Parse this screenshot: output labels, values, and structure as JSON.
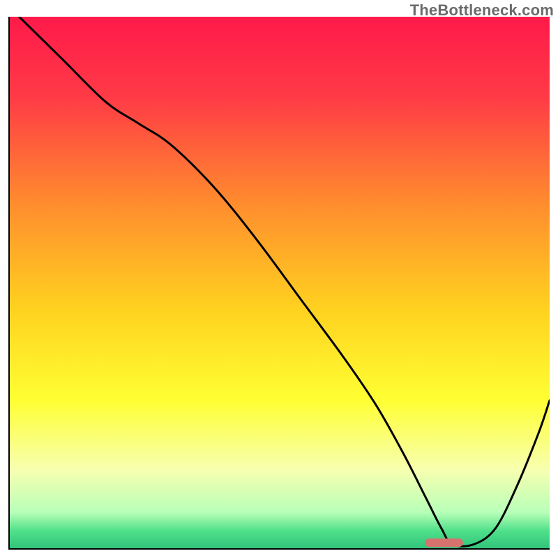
{
  "watermark": "TheBottleneck.com",
  "chart_data": {
    "type": "line",
    "title": "",
    "xlabel": "",
    "ylabel": "",
    "xlim": [
      0,
      100
    ],
    "ylim": [
      0,
      100
    ],
    "grid": false,
    "legend": false,
    "background_gradient": [
      {
        "offset": 0.0,
        "color": "#ff1a4a"
      },
      {
        "offset": 0.15,
        "color": "#ff3a46"
      },
      {
        "offset": 0.35,
        "color": "#ff8c2e"
      },
      {
        "offset": 0.55,
        "color": "#ffd21f"
      },
      {
        "offset": 0.72,
        "color": "#ffff33"
      },
      {
        "offset": 0.85,
        "color": "#f7ffb0"
      },
      {
        "offset": 0.93,
        "color": "#b8ffb8"
      },
      {
        "offset": 0.965,
        "color": "#4fe08a"
      },
      {
        "offset": 1.0,
        "color": "#2fc27a"
      }
    ],
    "series": [
      {
        "name": "bottleneck-curve",
        "color": "#000000",
        "x": [
          2,
          10,
          18,
          24,
          30,
          38,
          46,
          54,
          62,
          68,
          73,
          77,
          80,
          82,
          86,
          90,
          94,
          98,
          100
        ],
        "values": [
          100,
          92,
          84,
          80,
          76,
          68,
          58,
          47,
          36,
          27,
          18,
          10,
          4,
          1,
          1,
          4,
          12,
          22,
          28
        ]
      }
    ],
    "marker": {
      "name": "optimal-marker",
      "x_start": 77,
      "x_end": 84,
      "y": 1.3,
      "height": 1.6,
      "color": "#d6736f"
    }
  }
}
